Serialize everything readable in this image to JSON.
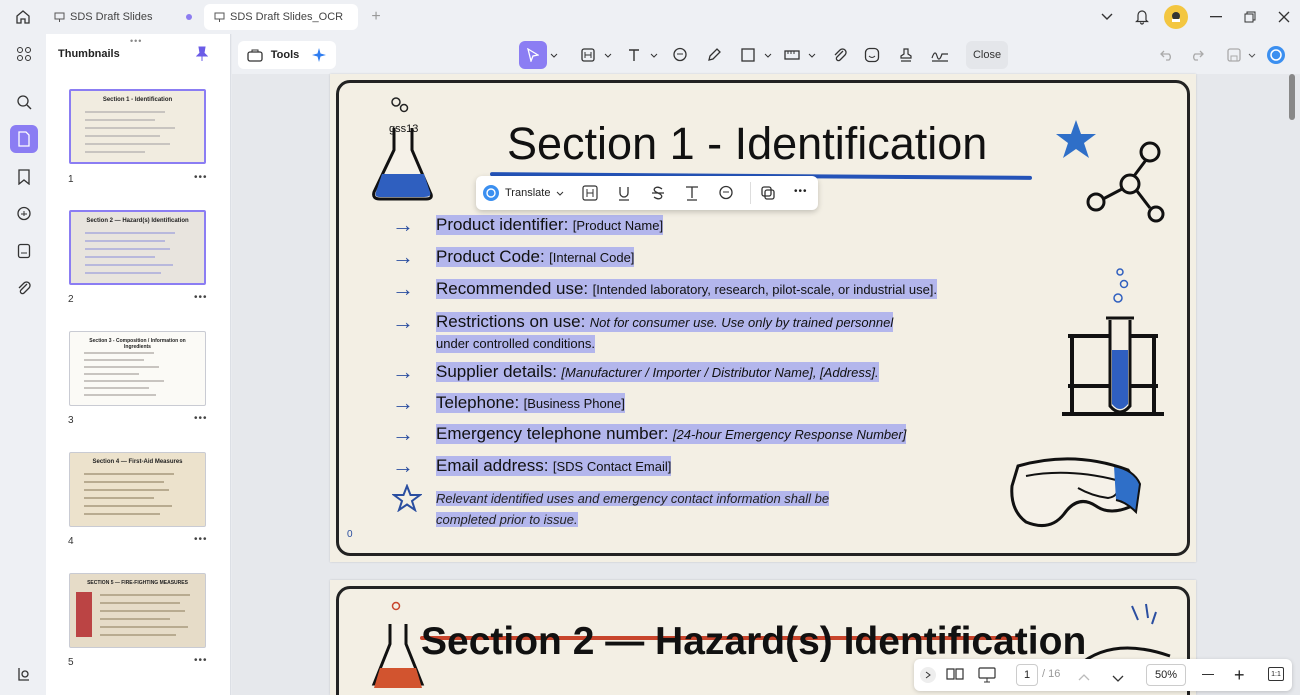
{
  "tabs": [
    {
      "label": "SDS Draft Slides"
    },
    {
      "label": "SDS Draft Slides_OCR"
    }
  ],
  "panel": {
    "title": "Thumbnails"
  },
  "thumbnails": [
    {
      "num": "1",
      "title": "Section 1 - Identification"
    },
    {
      "num": "2",
      "title": "Section 2 — Hazard(s) Identification"
    },
    {
      "num": "3",
      "title": "Section 3 - Composition / Information on Ingredients"
    },
    {
      "num": "4",
      "title": "Section 4 — First-Aid Measures"
    },
    {
      "num": "5",
      "title": "SECTION 5 — FIRE-FIGHTING MEASURES"
    }
  ],
  "toolbar": {
    "tools_label": "Tools",
    "close_label": "Close"
  },
  "floating_toolbar": {
    "translate_label": "Translate"
  },
  "page1": {
    "title": "Section 1 - Identification",
    "flask_label": "gss13",
    "corner_mark": "0",
    "rows": [
      {
        "label": "Product identifier:",
        "value": "[Product Name]"
      },
      {
        "label": "Product Code:",
        "value": "[Internal Code]"
      },
      {
        "label": "Recommended use:",
        "value": "[Intended laboratory, research, pilot-scale, or industrial use]."
      },
      {
        "label": "Restrictions on use:",
        "value": "Not for consumer use. Use only by trained personnel",
        "value2": "under controlled conditions."
      },
      {
        "label": "Supplier details:",
        "value": "[Manufacturer / Importer / Distributor Name], [Address]."
      },
      {
        "label": "Telephone:",
        "value": "[Business Phone]"
      },
      {
        "label": "Emergency telephone number:",
        "value": "[24-hour Emergency Response Number]"
      },
      {
        "label": "Email address:",
        "value": "[SDS Contact Email]"
      }
    ],
    "note_line1": "Relevant identified uses and emergency contact information shall be",
    "note_line2": "completed prior to issue."
  },
  "page2": {
    "title": "Section 2 — Hazard(s) Identification"
  },
  "bottom": {
    "page_current": "1",
    "page_total": "/ 16",
    "zoom": "50%",
    "fit_label": "1:1"
  },
  "colors": {
    "accent": "#8b7df3",
    "highlight": "#b3b6ec",
    "underline_blue": "#2453b8",
    "underline_red": "#c8452c"
  }
}
